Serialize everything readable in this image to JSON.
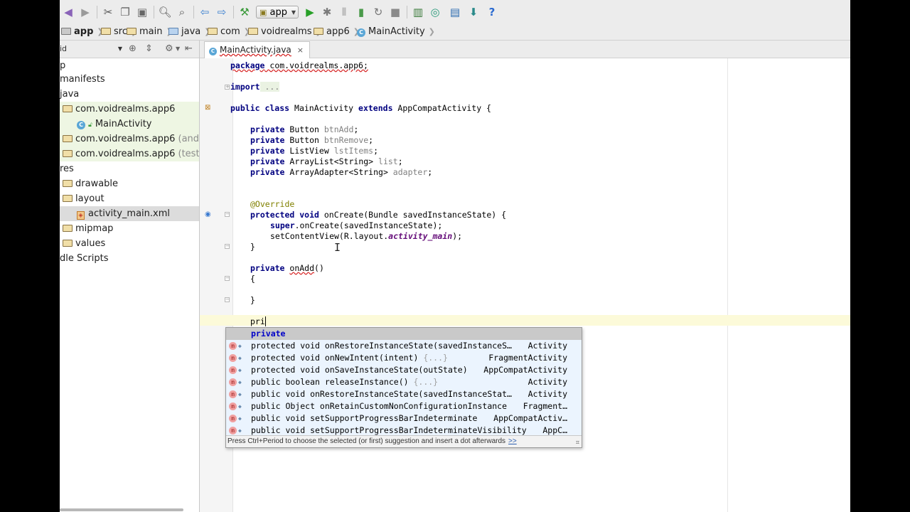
{
  "toolbar": {
    "run_config": "app",
    "icons": [
      "undo-icon",
      "redo-icon",
      "cut-icon",
      "copy-icon",
      "paste-icon",
      "find-icon",
      "replace-icon",
      "back-icon",
      "forward-icon",
      "make-project-icon",
      "run-icon",
      "debug-icon",
      "attach-debugger-icon",
      "apply-changes-icon",
      "rerun-icon",
      "stop-icon",
      "avd-manager-icon",
      "sync-gradle-icon",
      "project-structure-icon",
      "sdk-manager-icon",
      "help-icon"
    ]
  },
  "breadcrumb": [
    "app",
    "src",
    "main",
    "java",
    "com",
    "voidrealms",
    "app6",
    "MainActivity"
  ],
  "project_panel": {
    "view_label": "id",
    "tree": [
      {
        "label": "p",
        "highlight": "none"
      },
      {
        "label": "manifests",
        "highlight": "none"
      },
      {
        "label": "java",
        "highlight": "none"
      },
      {
        "label": "com.voidrealms.app6",
        "suffix": "",
        "highlight": "green"
      },
      {
        "label": "MainActivity",
        "highlight": "green"
      },
      {
        "label": "com.voidrealms.app6",
        "suffix": "(androidT",
        "highlight": "green"
      },
      {
        "label": "com.voidrealms.app6",
        "suffix": "(test)",
        "highlight": "green"
      },
      {
        "label": "res",
        "highlight": "none"
      },
      {
        "label": "drawable",
        "highlight": "none"
      },
      {
        "label": "layout",
        "highlight": "none"
      },
      {
        "label": "activity_main.xml",
        "highlight": "selected"
      },
      {
        "label": "mipmap",
        "highlight": "none"
      },
      {
        "label": "values",
        "highlight": "none"
      },
      {
        "label": "dle Scripts",
        "highlight": "none"
      }
    ]
  },
  "editor": {
    "tab_label": "MainActivity.java",
    "close_glyph": "×",
    "code": {
      "pkg_kw": "package",
      "pkg_name": " com.voidrealms.app6;",
      "import_kw": "import",
      "import_fold": " ...",
      "class_kw1": "public class",
      "class_name": " MainActivity ",
      "class_kw2": "extends",
      "class_rest": " AppCompatActivity {",
      "f1_type": " Button ",
      "f1_name": "btnAdd",
      "f2_type": " Button ",
      "f2_name": "btnRemove",
      "f3_type": " ListView ",
      "f3_name": "lstItems",
      "f4_type": " ArrayList<String> ",
      "f4_name": "list",
      "f5_type": " ArrayAdapter<String> ",
      "f5_name": "adapter",
      "private_kw": "private",
      "semicolon": ";",
      "override": "@Override",
      "oncreate_kw": "protected void",
      "oncreate_rest": " onCreate(Bundle savedInstanceState) {",
      "super_kw": "super",
      "super_rest": ".onCreate(savedInstanceState);",
      "setcv_pre": "setContentView(R.layout.",
      "setcv_it": "activity_main",
      "setcv_post": ");",
      "close_brace": "}",
      "open_brace": "{",
      "onadd_name": "onAdd",
      "onadd_rest": "()",
      "typed": "pri"
    }
  },
  "completion": {
    "items": [
      {
        "pre": "",
        "hl": "",
        "text": "private",
        "hint": "",
        "type": "",
        "selected": true
      },
      {
        "pre": "protected void onRe",
        "hl": "",
        "text": "protected void onRestoreInstanceState(savedInstanceS…",
        "hint": "",
        "type": "Activity",
        "selected": false
      },
      {
        "pre": "",
        "hl": "",
        "text": "protected void onNewIntent(intent)",
        "hint": " {...}",
        "type": "FragmentActivity",
        "selected": false
      },
      {
        "pre": "",
        "hl": "",
        "text": "protected void onSaveInstanceState(outState)",
        "hint": "",
        "type": "AppCompatActivity",
        "selected": false
      },
      {
        "pre": "",
        "hl": "",
        "text": "public boolean releaseInstance()",
        "hint": " {...}",
        "type": "Activity",
        "selected": false
      },
      {
        "pre": "",
        "hl": "",
        "text": "public void onRestoreInstanceState(savedInstanceStat…",
        "hint": "",
        "type": "Activity",
        "selected": false
      },
      {
        "pre": "",
        "hl": "",
        "text": "public Object onRetainCustomNonConfigurationInstance",
        "hint": "",
        "type": "Fragment…",
        "selected": false
      },
      {
        "pre": "",
        "hl": "",
        "text": "public void setSupportProgressBarIndeterminate",
        "hint": "",
        "type": "AppCompatActiv…",
        "selected": false
      },
      {
        "pre": "",
        "hl": "",
        "text": "public void setSupportProgressBarIndeterminateVisibility",
        "hint": "",
        "type": "AppC…",
        "selected": false
      }
    ],
    "hint": "Press Ctrl+Period to choose the selected (or first) suggestion and insert a dot afterwards",
    "hint_link": ">>"
  }
}
